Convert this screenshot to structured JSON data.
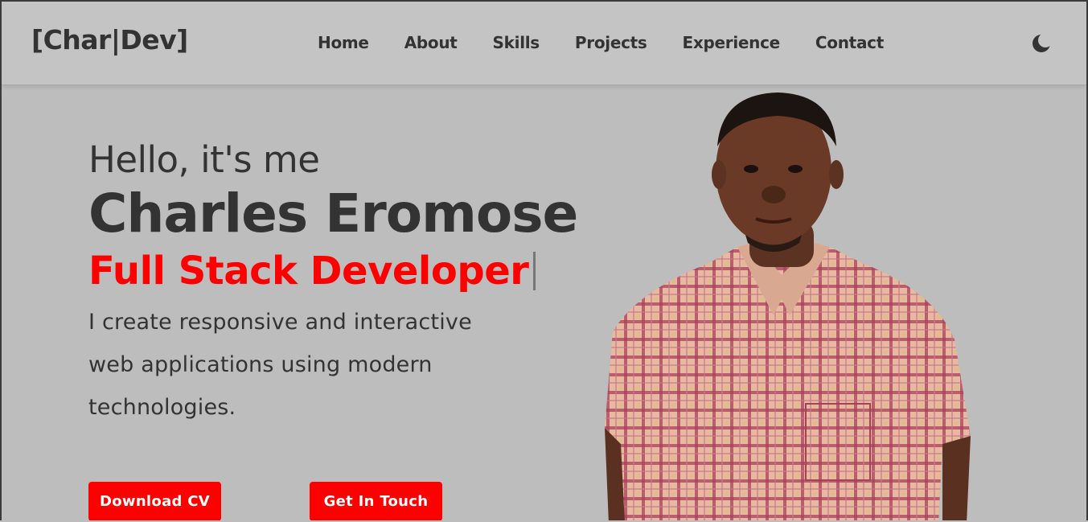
{
  "nav": {
    "logo": "[Char|Dev]",
    "links": [
      "Home",
      "About",
      "Skills",
      "Projects",
      "Experience",
      "Contact"
    ],
    "theme_icon": "moon-icon"
  },
  "hero": {
    "greeting": "Hello, it's me",
    "name": "Charles Eromose",
    "role": "Full Stack Developer",
    "description": "I create responsive and interactive web applications using modern technologies.",
    "buttons": {
      "download_cv": "Download CV",
      "get_in_touch": "Get In Touch"
    }
  },
  "colors": {
    "background": "#bdbdbd",
    "navbar": "#c4c4c4",
    "text": "#333333",
    "accent": "#ff0000"
  }
}
